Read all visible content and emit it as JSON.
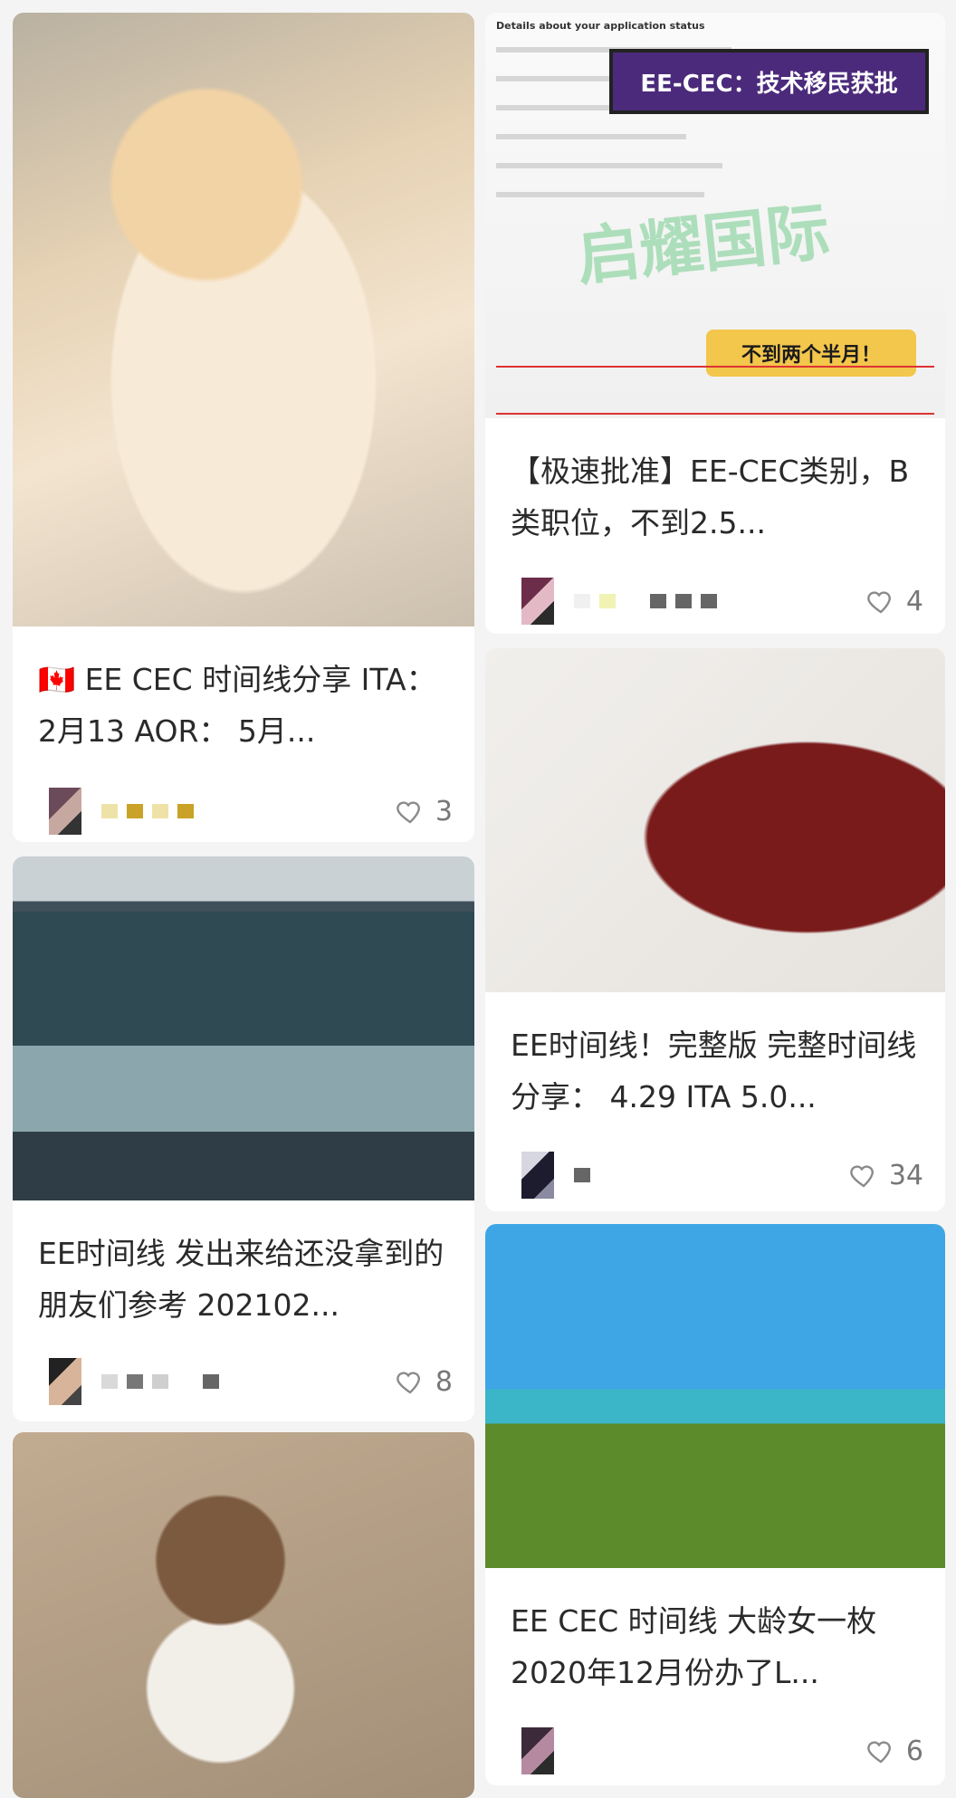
{
  "cards": [
    {
      "title": "🇨🇦 EE CEC 时间线分享 ITA： 2月13 AOR： 5月...",
      "likes": "3"
    },
    {
      "title": "【极速批准】EE-CEC类别，B类职位，不到2.5...",
      "likes": "4",
      "image_text": {
        "heading": "Details about your application status",
        "banner": "EE-CEC：技术移民获批",
        "badge": "不到两个半月！",
        "watermark": "启耀国际"
      }
    },
    {
      "title": "EE时间线！完整版 完整时间线分享： 4.29 ITA 5.0...",
      "likes": "34"
    },
    {
      "title": "EE时间线 发出来给还没拿到的朋友们参考 202102...",
      "likes": "8"
    },
    {
      "title": "EE CEC 时间线 大龄女一枚 2020年12月份办了L...",
      "likes": "6"
    }
  ],
  "colors": {
    "background": "#f4f4f4",
    "card": "#ffffff",
    "text": "#2a2a2a",
    "muted": "#777777"
  }
}
